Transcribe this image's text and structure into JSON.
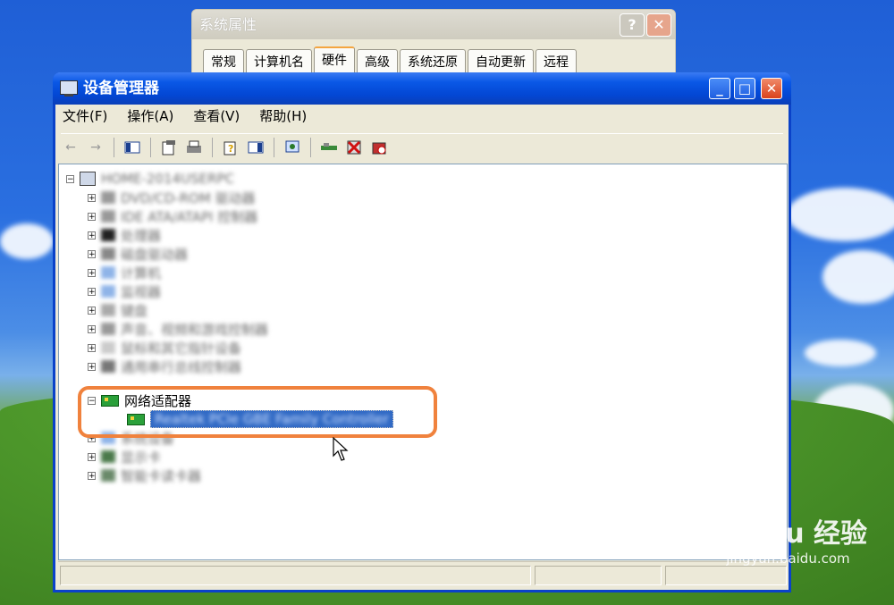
{
  "system_properties": {
    "title": "系统属性",
    "tabs": [
      "常规",
      "计算机名",
      "硬件",
      "高级",
      "系统还原",
      "自动更新",
      "远程"
    ],
    "active_tab": "硬件",
    "help_btn": "?",
    "close_btn": "✕"
  },
  "device_manager": {
    "title": "设备管理器",
    "menu": [
      "文件(F)",
      "操作(A)",
      "查看(V)",
      "帮助(H)"
    ],
    "window_buttons": {
      "minimize": "_",
      "maximize": "□",
      "close": "✕"
    },
    "tree": {
      "root_label": "HOME-2014USERPC",
      "categories": [
        "DVD/CD-ROM 驱动器",
        "IDE ATA/ATAPI 控制器",
        "处理器",
        "磁盘驱动器",
        "计算机",
        "监视器",
        "键盘",
        "声音、视频和游戏控制器",
        "鼠标和其它指针设备",
        "通用串行总线控制器",
        "网络适配器",
        "系统设备",
        "显示卡",
        "智能卡读卡器"
      ],
      "network_adapter_label": "网络适配器",
      "network_adapter_child": "Realtek PCIe GBE Family Controller"
    }
  },
  "watermark": {
    "brand": "Bai du 经验",
    "url": "jingyan.baidu.com"
  },
  "colors": {
    "titlebar": "#0a58e6",
    "selection": "#316ac5",
    "highlight": "#f0823d"
  }
}
